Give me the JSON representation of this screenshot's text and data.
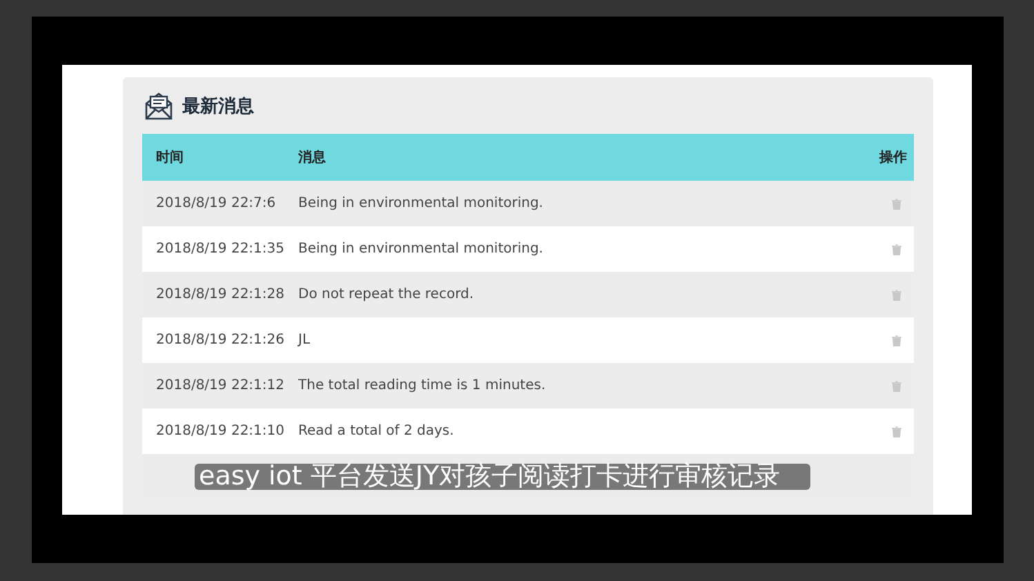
{
  "panel": {
    "title": "最新消息"
  },
  "table": {
    "columns": [
      "时间",
      "消息",
      "操作"
    ],
    "rows": [
      {
        "time": "2018/8/19 22:7:6",
        "message": "Being in environmental monitoring."
      },
      {
        "time": "2018/8/19 22:1:35",
        "message": "Being in environmental monitoring."
      },
      {
        "time": "2018/8/19 22:1:28",
        "message": "Do not repeat the record."
      },
      {
        "time": "2018/8/19 22:1:26",
        "message": "JL"
      },
      {
        "time": "2018/8/19 22:1:12",
        "message": "The total reading time is 1 minutes."
      },
      {
        "time": "2018/8/19 22:1:10",
        "message": "Read a total of 2 days."
      }
    ]
  },
  "subtitle": "easy iot 平台发送JY对孩子阅读打卡进行审核记录"
}
